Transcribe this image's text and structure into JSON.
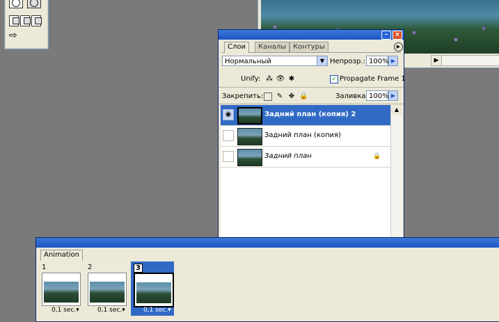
{
  "layers_panel": {
    "tabs": [
      "Слои",
      "Каналы",
      "Контуры"
    ],
    "blend_mode": "Нормальный",
    "opacity_label": "Непрозр.:",
    "opacity_value": "100%",
    "unify_label": "Unify:",
    "propagate_label": "Propagate Frame 1",
    "propagate_checked": true,
    "lock_label": "Закрепить:",
    "fill_label": "Заливка:",
    "fill_value": "100%",
    "layers": [
      {
        "name": "Задний план (копия) 2",
        "visible": true,
        "selected": true
      },
      {
        "name": "Задний план (копия)",
        "visible": false,
        "selected": false
      },
      {
        "name": "Задний план",
        "visible": false,
        "selected": false,
        "locked": true
      }
    ]
  },
  "animation_panel": {
    "tab": "Animation",
    "frames": [
      {
        "number": "1",
        "delay": "0,1 sec."
      },
      {
        "number": "2",
        "delay": "0,1 sec."
      },
      {
        "number": "3",
        "delay": "0,1 sec.",
        "selected": true
      }
    ]
  },
  "colors": {
    "title_blue": "#1c56c4",
    "selection": "#316ac5",
    "panel_bg": "#ece9d8",
    "workspace": "#7a7a7a"
  }
}
